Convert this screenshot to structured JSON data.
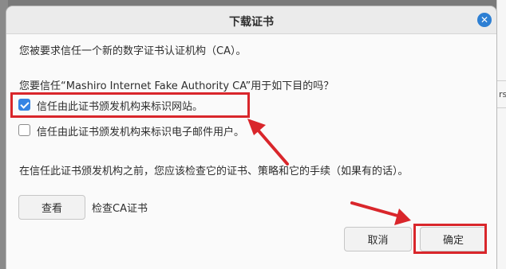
{
  "dialog": {
    "title": "下载证书",
    "intro": "您被要求信任一个新的数字证书认证机构（CA）。",
    "question": "您要信任“Mashiro Internet Fake Authority CA”用于如下目的吗？",
    "options": [
      {
        "label": "信任由此证书颁发机构来标识网站。",
        "checked": true
      },
      {
        "label": "信任由此证书颁发机构来标识电子邮件用户。",
        "checked": false
      }
    ],
    "advice": "在信任此证书颁发机构之前，您应该检查它的证书、策略和它的手续（如果有的话）。",
    "view_button": "查看",
    "view_label": "检查CA证书",
    "cancel_button": "取消",
    "ok_button": "确定"
  },
  "background": {
    "fragment": "rs"
  },
  "colors": {
    "accent": "#3584e4",
    "annotation": "#d9262b",
    "close_button": "#2d7fd3"
  },
  "icons": {
    "close": "close-icon",
    "check": "checkmark-icon"
  }
}
